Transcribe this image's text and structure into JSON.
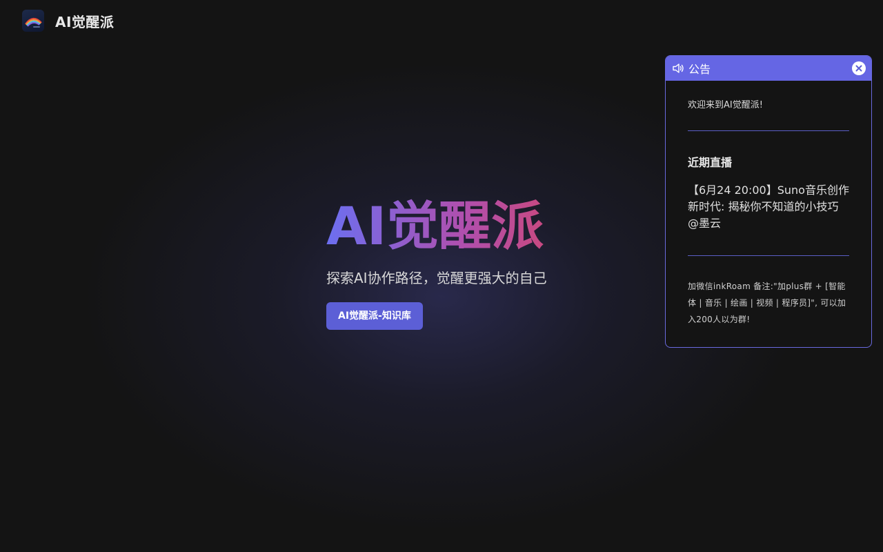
{
  "header": {
    "site_title": "AI觉醒派",
    "logo_icon": "rainbow-logo-icon"
  },
  "hero": {
    "title": "AI觉醒派",
    "tagline": "探索AI协作路径，觉醒更强大的自己",
    "button_label": "AI觉醒派-知识库",
    "title_gradient": [
      "#6c6ff0",
      "#b04fae",
      "#e04352"
    ],
    "button_color": "#5c5fd6"
  },
  "notice": {
    "title": "公告",
    "header_color": "#6566e4",
    "welcome": "欢迎来到AI觉醒派!",
    "live_heading": "近期直播",
    "live_item": "【6月24 20:00】Suno音乐创作新时代: 揭秘你不知道的小技巧 @墨云",
    "contact": "加微信inkRoam 备注:\"加plus群 + [智能体 | 音乐 | 绘画 | 视频 | 程序员]\", 可以加入200人以为群!",
    "icons": {
      "speaker": "speaker-icon",
      "close": "close-icon"
    }
  },
  "colors": {
    "background": "#141414",
    "accent": "#6566e4"
  }
}
